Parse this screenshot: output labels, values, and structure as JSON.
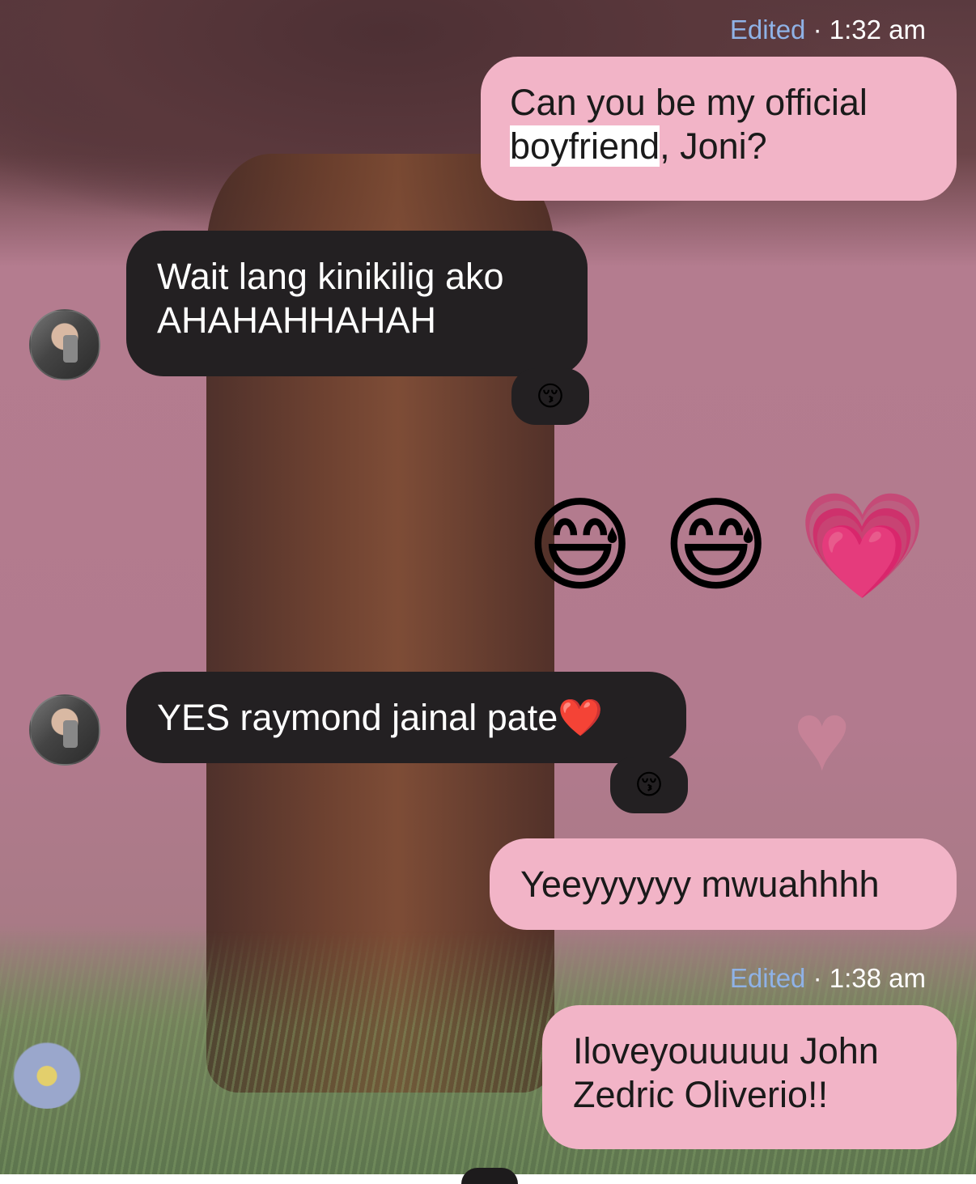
{
  "messages": [
    {
      "id": "m1",
      "direction": "outgoing",
      "meta": {
        "edited": "Edited",
        "sep": "·",
        "time": "1:32 am"
      },
      "text_parts": [
        "Can you be my official ",
        "boyfriend",
        ", Joni?"
      ]
    },
    {
      "id": "m2",
      "direction": "incoming",
      "text_lines": [
        "Wait lang kinikilig ako",
        "AHAHAHHAHAH"
      ],
      "reaction": "😚"
    },
    {
      "id": "m3",
      "direction": "outgoing",
      "emoji": [
        "😅",
        "😅",
        "💗"
      ]
    },
    {
      "id": "m4",
      "direction": "incoming",
      "text": "YES raymond jainal pate❤️",
      "reaction": "😚"
    },
    {
      "id": "m5",
      "direction": "outgoing",
      "text": "Yeeyyyyyy mwuahhhh"
    },
    {
      "id": "m6",
      "direction": "outgoing",
      "meta": {
        "edited": "Edited",
        "sep": "·",
        "time": "1:38 am"
      },
      "text_lines": [
        "Iloveyouuuuu John",
        "Zedric Oliverio!!"
      ]
    }
  ],
  "colors": {
    "outgoing_bubble": "#f2b4c7",
    "incoming_bubble": "#232022",
    "edited_label": "#8fb2e6"
  },
  "icons": {
    "avatar": "contact-avatar"
  }
}
